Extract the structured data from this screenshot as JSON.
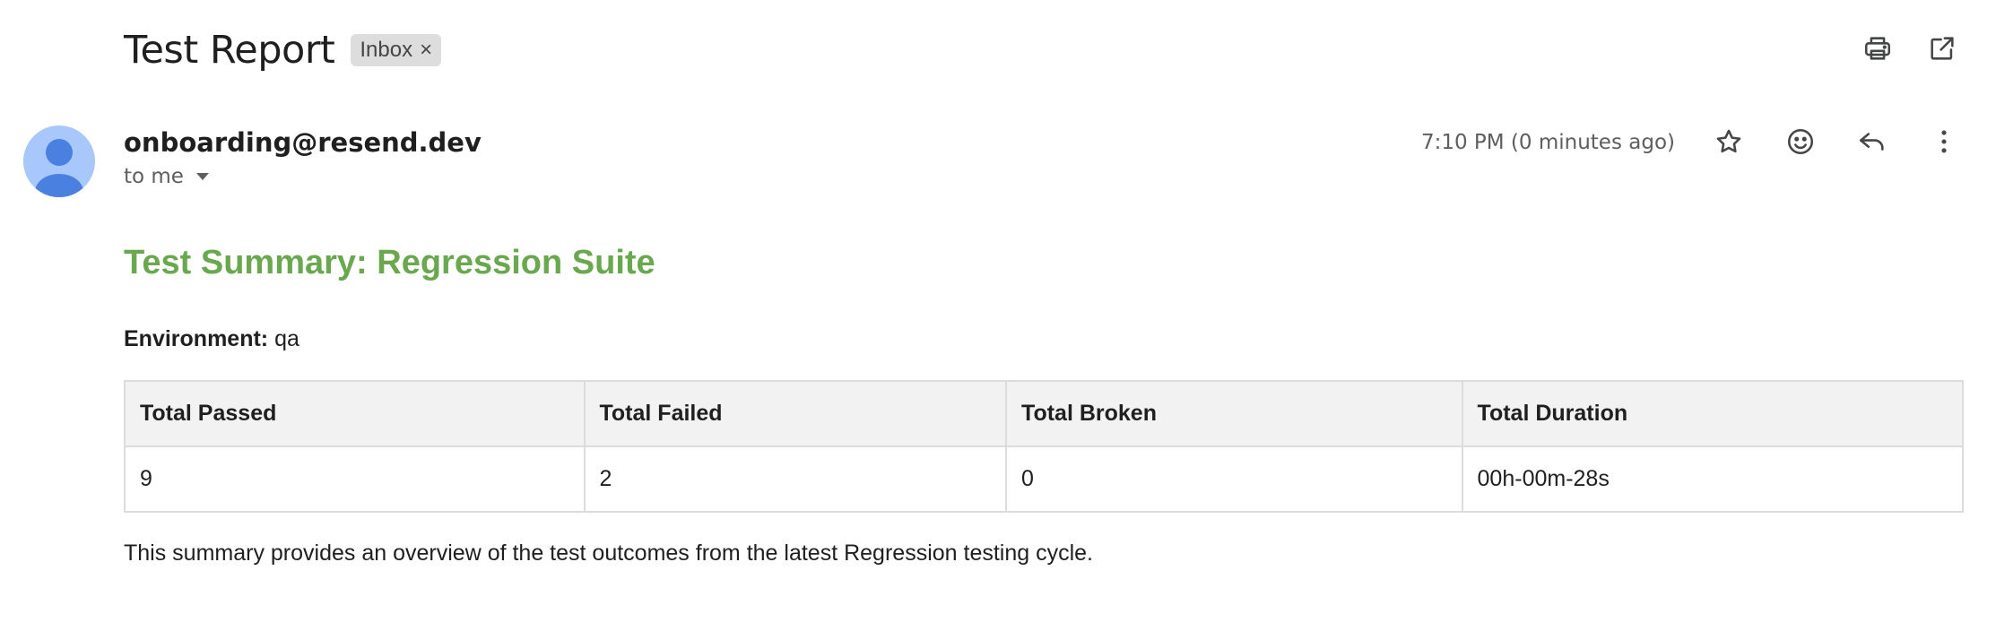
{
  "header": {
    "subject": "Test Report",
    "label": "Inbox",
    "label_remove": "×"
  },
  "top_actions": [
    {
      "name": "print-icon"
    },
    {
      "name": "open-in-new-window-icon"
    }
  ],
  "message": {
    "sender": "onboarding@resend.dev",
    "recipient": "to me",
    "time": "7:10 PM (0 minutes ago)",
    "actions": [
      "star-icon",
      "emoji-reaction-icon",
      "reply-icon",
      "more-options-icon"
    ]
  },
  "body": {
    "title": "Test Summary: Regression Suite",
    "environment_label": "Environment:",
    "environment_value": "qa",
    "table": {
      "headers": [
        "Total Passed",
        "Total Failed",
        "Total Broken",
        "Total Duration"
      ],
      "rows": [
        [
          "9",
          "2",
          "0",
          "00h-00m-28s"
        ]
      ]
    },
    "footer": "This summary provides an overview of the test outcomes from the latest Regression testing cycle."
  },
  "colors": {
    "accent_green": "#6aa84f",
    "avatar_bg": "#a8c7fa",
    "avatar_fg": "#4a80e0",
    "chip_bg": "#dddddd",
    "table_header_bg": "#f2f2f2"
  }
}
